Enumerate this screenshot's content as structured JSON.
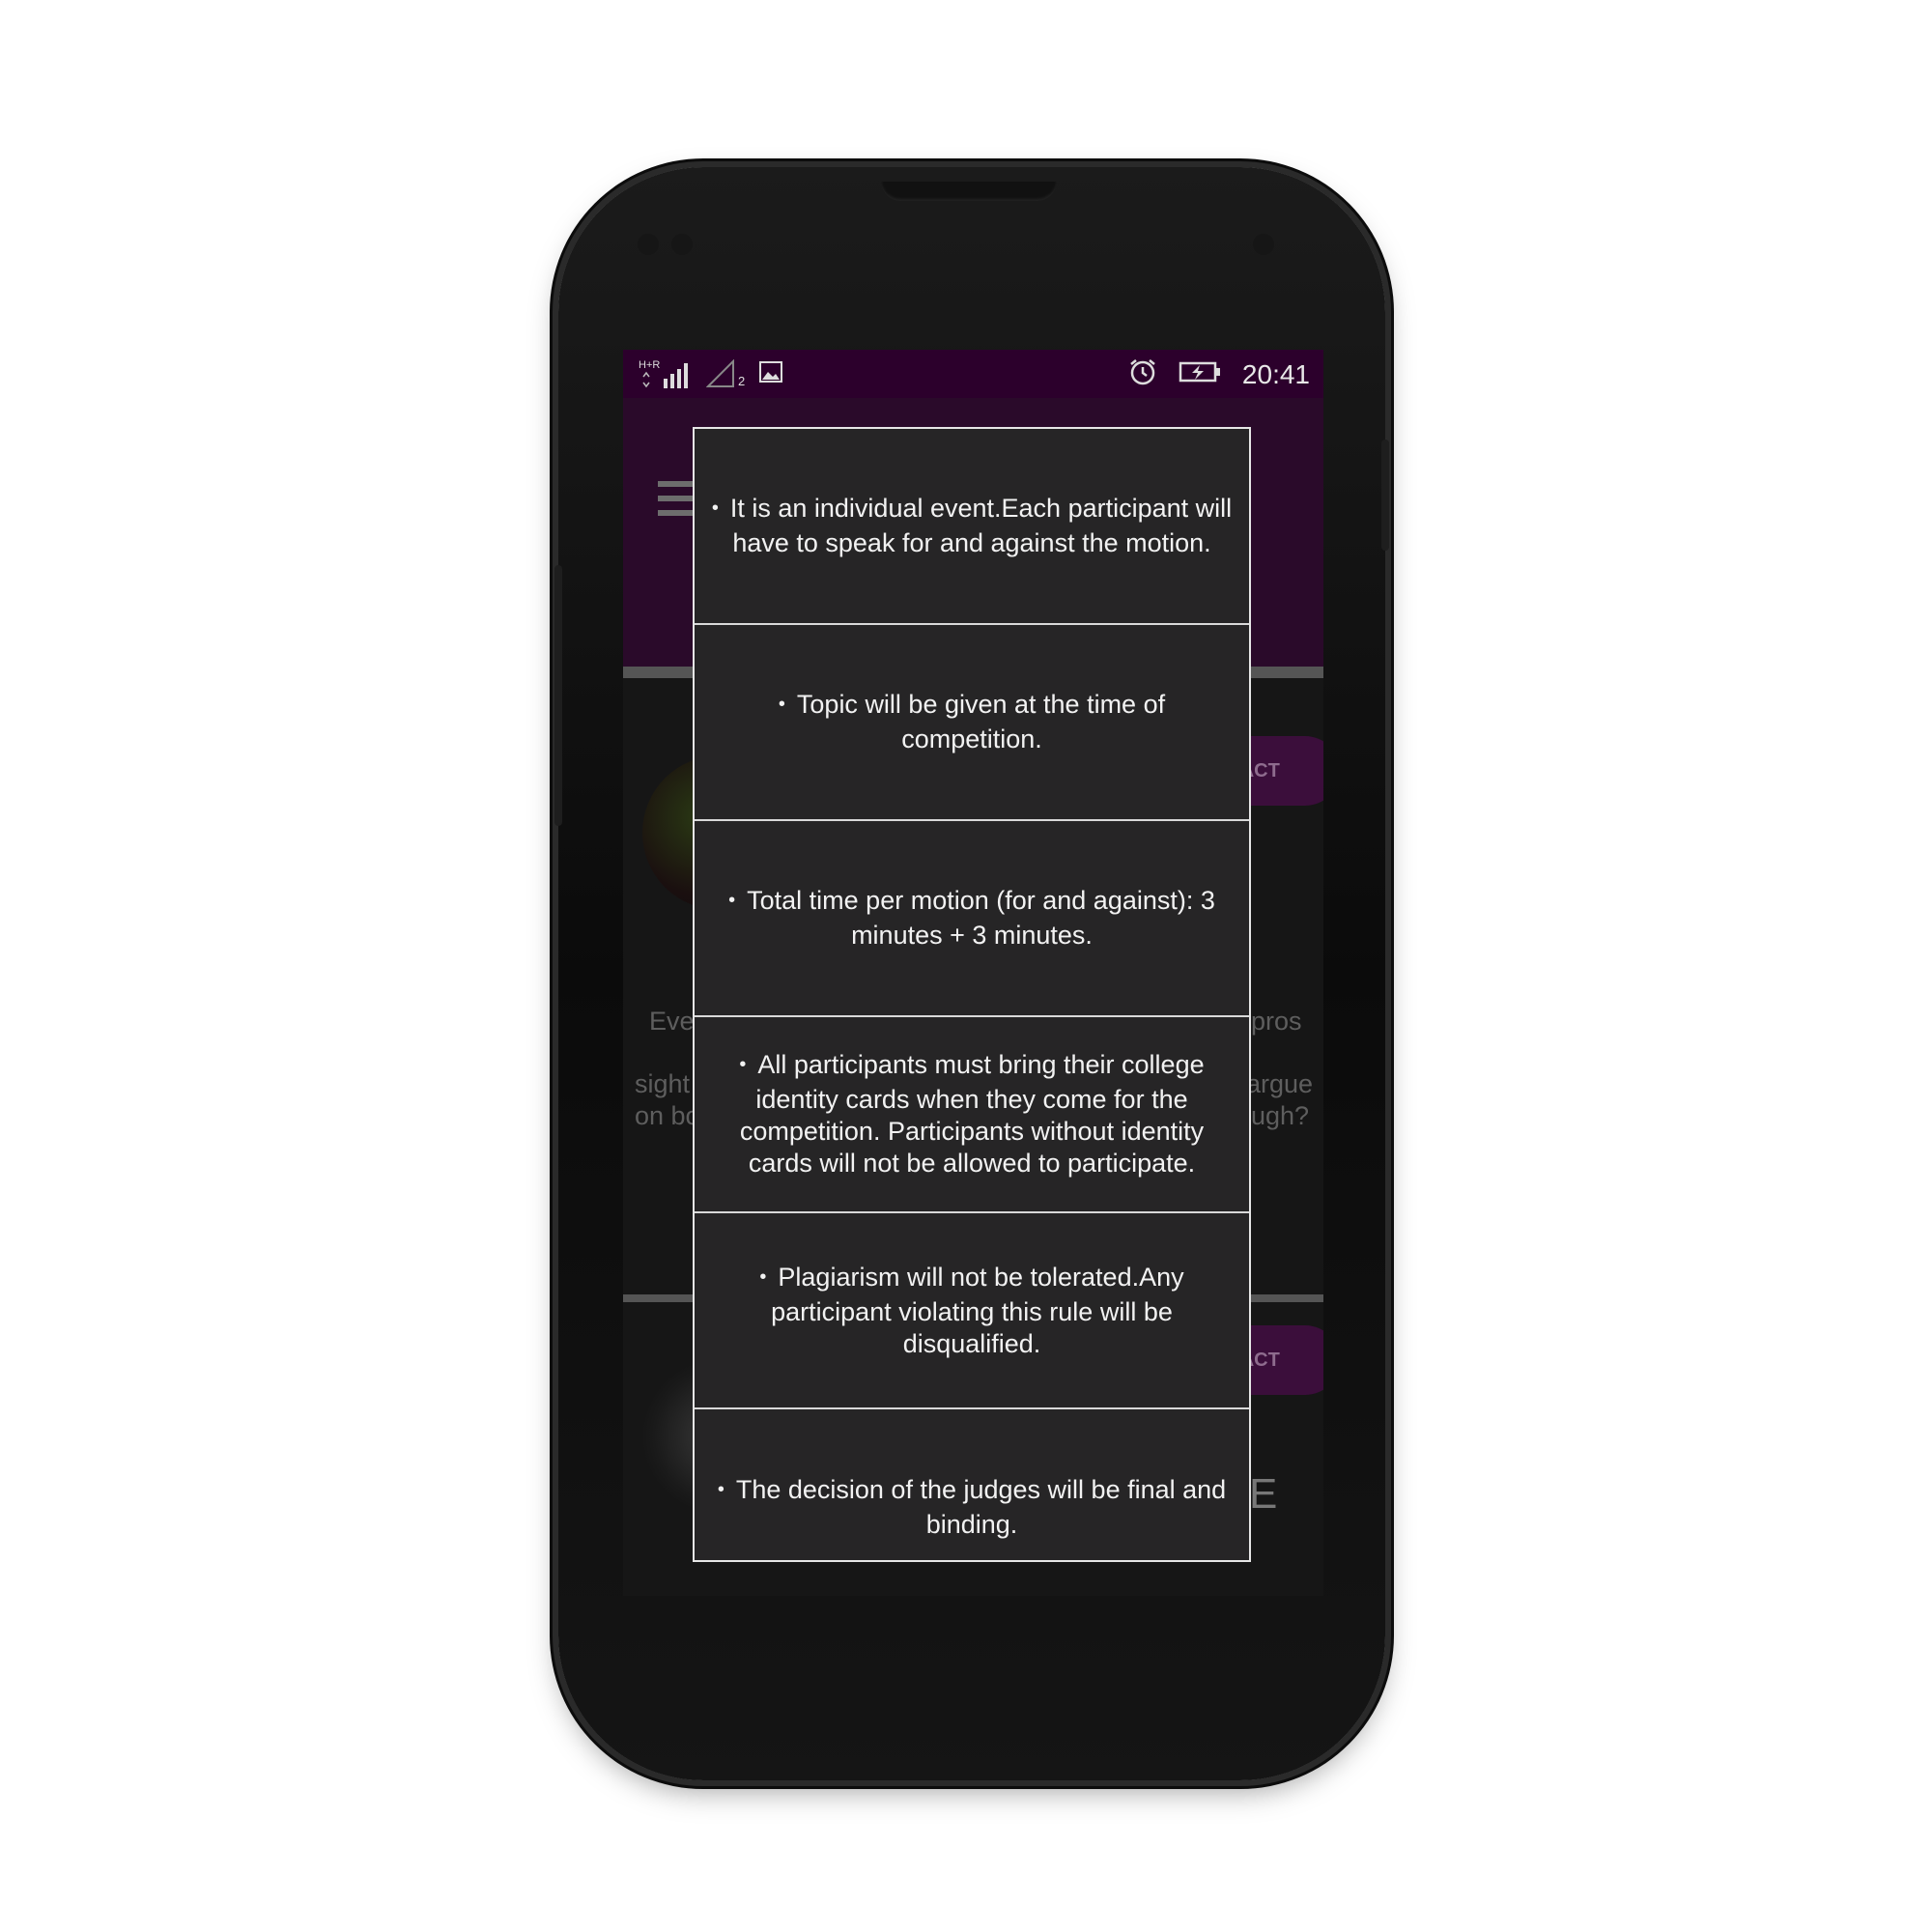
{
  "status_bar": {
    "network_label": "H+R",
    "sim_label": "2",
    "time": "20:41"
  },
  "background_app": {
    "contact_label_1": "TACT",
    "contact_label_2": "TACT",
    "text_fragment_left_1": "Eve",
    "text_fragment_left_2": "sight",
    "text_fragment_left_3": "on bo",
    "text_fragment_right_1": "pros",
    "text_fragment_right_2": "argue",
    "text_fragment_right_3": "ugh?",
    "text_fragment_e": "E"
  },
  "rules_dialog": {
    "bullet": "•",
    "items": [
      {
        "text": "It is an individual event.Each participant will have to speak for and against the motion."
      },
      {
        "text": "Topic will be given at the time of competition."
      },
      {
        "text": "Total time per motion (for and against): 3 minutes + 3 minutes."
      },
      {
        "text": "All participants must bring their college identity cards when they come for the competition. Participants without identity cards will not be allowed to participate."
      },
      {
        "text": "Plagiarism will not be tolerated.Any participant violating this rule will be disqualified."
      },
      {
        "text": "The decision of the judges will be final and binding."
      }
    ]
  },
  "icons": {
    "signal": "signal-bars-icon",
    "sim2_signal": "signal-empty-icon",
    "image": "image-notification-icon",
    "alarm": "alarm-clock-icon",
    "battery": "battery-charging-icon",
    "menu": "hamburger-menu-icon"
  }
}
